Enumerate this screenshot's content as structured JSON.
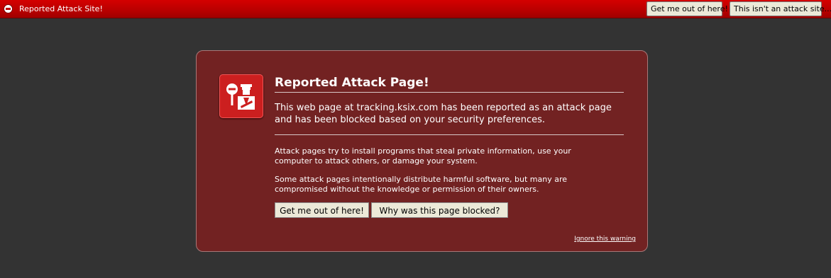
{
  "notification_bar": {
    "icon": "stop-icon",
    "text": "Reported Attack Site!",
    "get_out_label": "Get me out of here!",
    "not_attack_label": "This isn't an attack site..."
  },
  "error_page": {
    "icon": "police-officer-icon",
    "title": "Reported Attack Page!",
    "short_desc": "This web page at tracking.ksix.com has been reported as an attack page and has been blocked based on your security preferences.",
    "long_desc_1": "Attack pages try to install programs that steal private information, use your computer to attack others, or damage your system.",
    "long_desc_2": "Some attack pages intentionally distribute harmful software, but many are compromised without the knowledge or permission of their owners.",
    "get_out_label": "Get me out of here!",
    "why_blocked_label": "Why was this page blocked?",
    "ignore_label": "Ignore this warning"
  },
  "colors": {
    "bar_red": "#c00000",
    "page_bg": "#333333",
    "panel_bg": "#722222"
  }
}
